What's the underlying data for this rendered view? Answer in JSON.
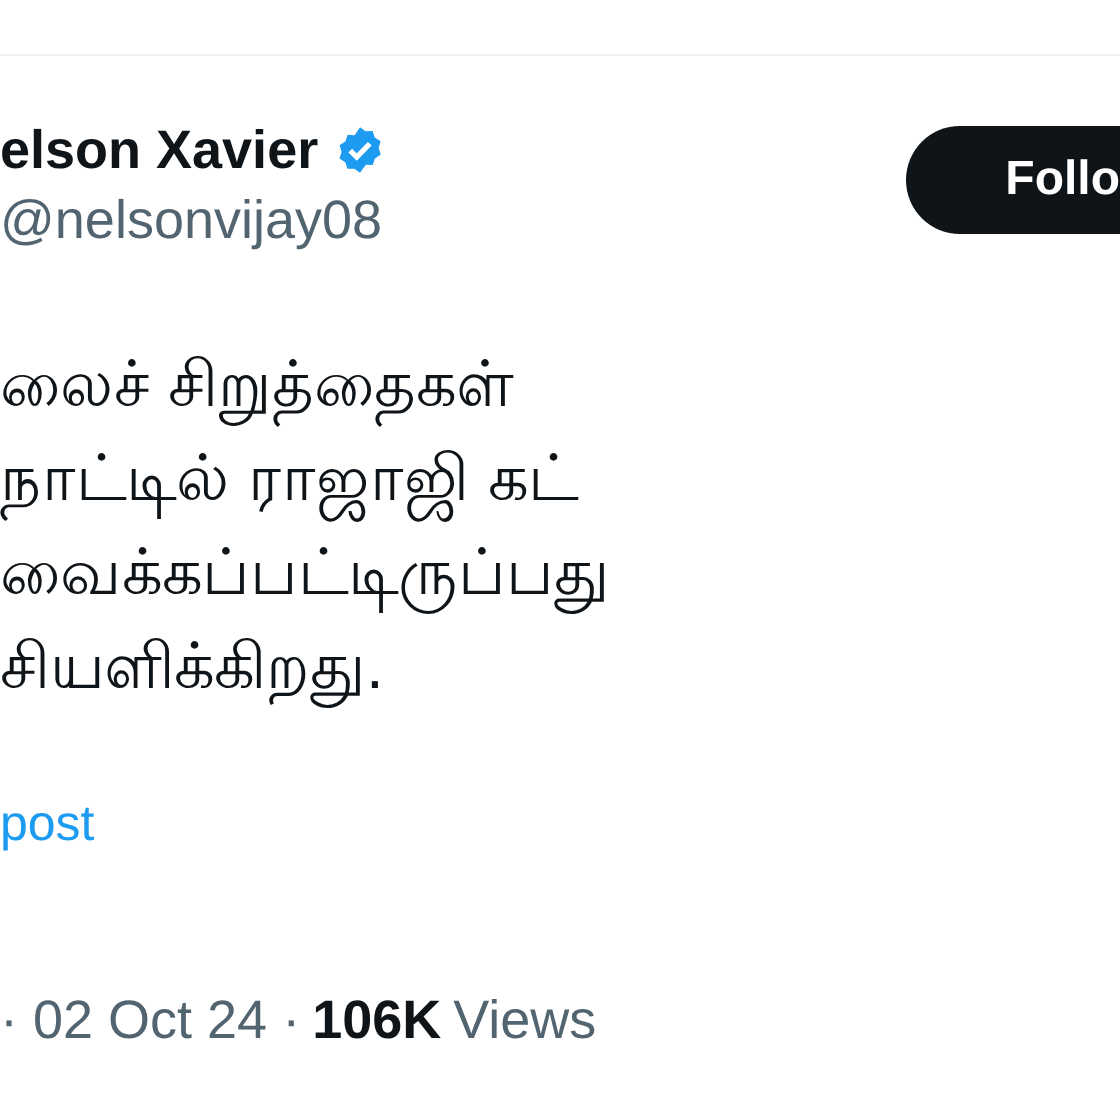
{
  "author": {
    "name": "elson Xavier",
    "verified": true,
    "handle": "@nelsonvijay08"
  },
  "follow_button": {
    "label": "Follo"
  },
  "tweet_lines": [
    "லைச் சிறுத்தைகள்",
    "நாட்டில் ராஜாஜி கட்",
    "வைக்கப்பட்டிருப்பது",
    "சியளிக்கிறது."
  ],
  "translate_link": "post",
  "meta": {
    "date": "· 02 Oct 24 ·",
    "views_count": "106K",
    "views_label": "Views"
  }
}
